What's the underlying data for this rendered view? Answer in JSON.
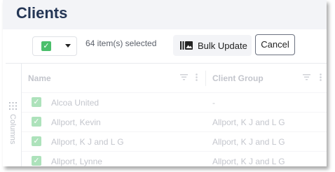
{
  "page": {
    "title": "Clients"
  },
  "toolbar": {
    "selected_text": "64 item(s) selected",
    "bulk_update_label": "Bulk Update",
    "cancel_label": "Cancel",
    "check_glyph": "✓"
  },
  "sidebar": {
    "columns_label": "Columns"
  },
  "table": {
    "headers": {
      "name": "Name",
      "client_group": "Client Group"
    },
    "rows": [
      {
        "name": "Alcoa United",
        "client_group": "-"
      },
      {
        "name": "Allport, Kevin",
        "client_group": "Allport, K J and L G"
      },
      {
        "name": "Allport, K J and L G",
        "client_group": "Allport, K J and L G"
      },
      {
        "name": "Allport, Lynne",
        "client_group": "Allport, K J and L G"
      }
    ]
  },
  "colors": {
    "accent": "#4bbf6b",
    "title": "#243655",
    "header_bg": "#f3f4f7"
  }
}
